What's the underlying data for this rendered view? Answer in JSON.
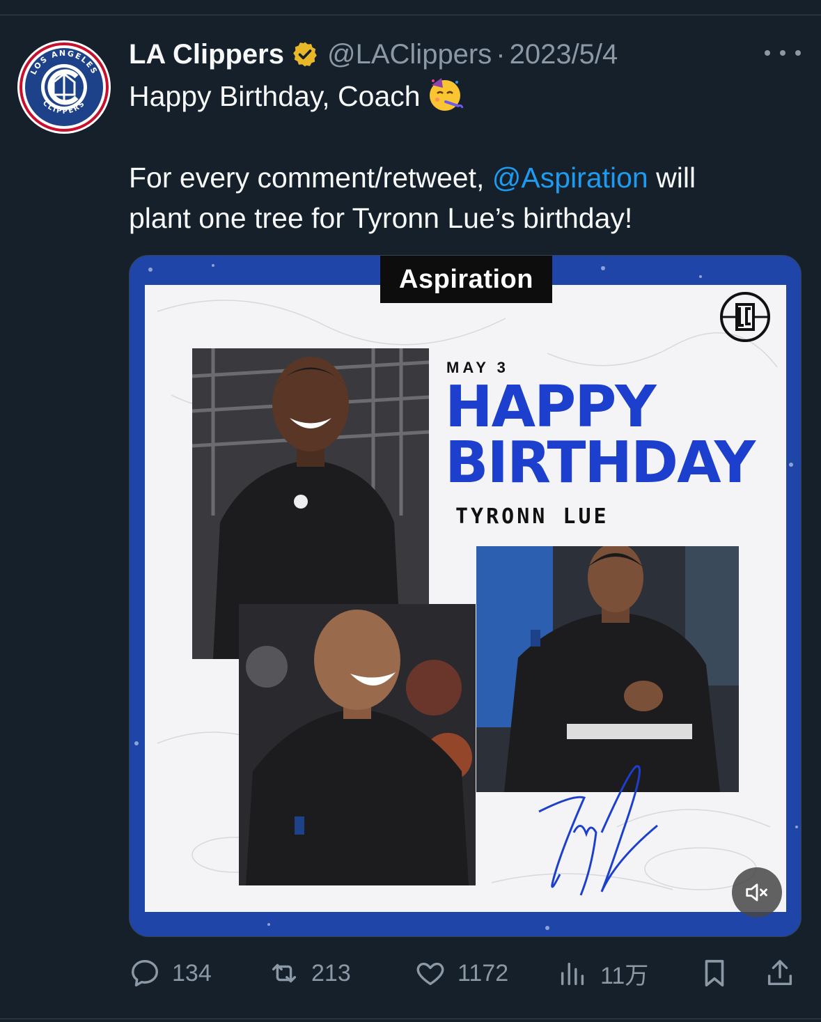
{
  "tweet": {
    "display_name": "LA Clippers",
    "handle": "@LAClippers",
    "separator": "·",
    "date": "2023/5/4",
    "text_line1": "Happy Birthday, Coach",
    "text_emoji": "partying-face-emoji",
    "text_line2_pre": "For every comment/retweet,",
    "text_line2_mention": "@Aspiration",
    "text_line2_post": "will",
    "text_line3": "plant one tree for Tyronn Lue’s birthday!"
  },
  "avatar": {
    "logo_text_top": "LOS ANGELES",
    "logo_text_bottom": "CLIPPERS"
  },
  "media": {
    "sponsor_tag": "Aspiration",
    "date_label": "MAY 3",
    "headline_line1": "HAPPY",
    "headline_line2": "BIRTHDAY",
    "coach_name": "TYRONN LUE",
    "mute_icon": "speaker-muted-icon"
  },
  "actions": {
    "replies": "134",
    "retweets": "213",
    "likes": "1172",
    "views": "11万"
  },
  "colors": {
    "background": "#15202b",
    "text_primary": "#f7f9f9",
    "text_secondary": "#8b98a5",
    "link": "#1d9bf0",
    "verified_gold": "#e8b829",
    "headline_blue": "#1d3fce"
  }
}
